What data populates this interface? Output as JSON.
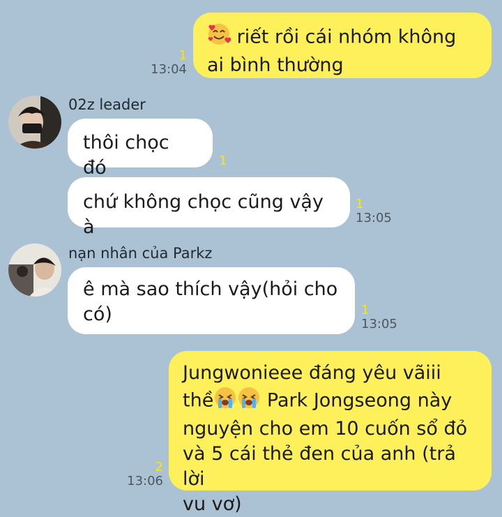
{
  "messages": {
    "m1": {
      "text": "riết rồi cái nhóm không ai bình thường",
      "read": "1",
      "time": "13:04"
    },
    "m2": {
      "sender": "02z leader",
      "text": "thôi chọc đó",
      "read": "1"
    },
    "m3": {
      "text": "chứ không chọc cũng vậy à",
      "read": "1",
      "time": "13:05"
    },
    "m4": {
      "sender": "nạn nhân của Parkz",
      "text_l1": "ê mà sao thích vậy(hỏi cho",
      "text_l2": "có)",
      "read": "1",
      "time": "13:05"
    },
    "m5": {
      "l1": "Jungwonieee đáng yêu vãiii",
      "l2_pre": "thề",
      "l2_post": " Park Jongseong này",
      "l3": "nguyện cho em 10 cuốn sổ đỏ",
      "l4": "và 5 cái thẻ đen của anh (trả lời",
      "l5": "vu vơ)",
      "read": "2",
      "time": "13:06"
    }
  },
  "icons": {
    "m1_emoji": "smiling-face-with-hearts-icon",
    "m5_emoji": "loudly-crying-face-icon"
  }
}
